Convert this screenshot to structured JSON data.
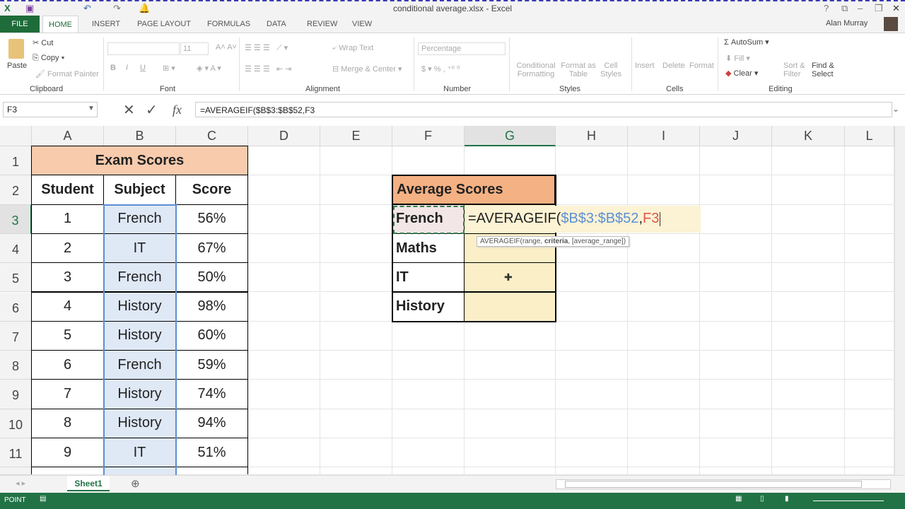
{
  "window": {
    "title": "conditional average.xlsx - Excel",
    "user": "Alan Murray",
    "controls": [
      "?",
      "⧉",
      "–",
      "❐",
      "✕"
    ]
  },
  "ribbon_tabs": [
    "FILE",
    "HOME",
    "INSERT",
    "PAGE LAYOUT",
    "FORMULAS",
    "DATA",
    "REVIEW",
    "VIEW"
  ],
  "ribbon": {
    "clipboard": {
      "paste": "Paste",
      "cut": "Cut",
      "copy": "Copy",
      "format_painter": "Format Painter",
      "label": "Clipboard"
    },
    "font": {
      "size": "11",
      "label": "Font",
      "bold": "B",
      "italic": "I",
      "underline": "U"
    },
    "alignment": {
      "wrap": "Wrap Text",
      "merge": "Merge & Center",
      "label": "Alignment"
    },
    "number": {
      "format": "Percentage",
      "label": "Number",
      "percent": "%"
    },
    "styles": {
      "conditional": "Conditional Formatting",
      "format_table": "Format as Table",
      "cell_styles": "Cell Styles",
      "label": "Styles"
    },
    "cells": {
      "insert": "Insert",
      "delete": "Delete",
      "format": "Format",
      "label": "Cells"
    },
    "editing": {
      "autosum": "AutoSum",
      "fill": "Fill",
      "clear": "Clear",
      "sort": "Sort & Filter",
      "find": "Find & Select",
      "label": "Editing"
    }
  },
  "formula_bar": {
    "name_box": "F3",
    "formula": "=AVERAGEIF($B$3:$B$52,F3",
    "fx": "fx"
  },
  "columns": [
    "A",
    "B",
    "C",
    "D",
    "E",
    "F",
    "G",
    "H",
    "I",
    "J",
    "K",
    "L"
  ],
  "rows": [
    "1",
    "2",
    "3",
    "4",
    "5",
    "6",
    "7",
    "8",
    "9",
    "10",
    "11"
  ],
  "exam": {
    "title": "Exam Scores",
    "headers": [
      "Student",
      "Subject",
      "Score"
    ],
    "data": [
      [
        "1",
        "French",
        "56%"
      ],
      [
        "2",
        "IT",
        "67%"
      ],
      [
        "3",
        "French",
        "50%"
      ],
      [
        "4",
        "History",
        "98%"
      ],
      [
        "5",
        "History",
        "60%"
      ],
      [
        "6",
        "French",
        "59%"
      ],
      [
        "7",
        "History",
        "74%"
      ],
      [
        "8",
        "History",
        "94%"
      ],
      [
        "9",
        "IT",
        "51%"
      ]
    ]
  },
  "averages": {
    "title": "Average Scores",
    "subjects": [
      "French",
      "Maths",
      "IT",
      "History"
    ]
  },
  "edit": {
    "prefix": "=AVERAGEIF(",
    "range": "$B$3:$B$52",
    "comma": ",",
    "criteria": "F3",
    "tooltip_pre": "AVERAGEIF(range, ",
    "tooltip_bold": "criteria",
    "tooltip_post": ", [average_range])"
  },
  "sheet_tabs": [
    "Sheet1"
  ],
  "status": {
    "mode": "POINT"
  },
  "colors": {
    "excel_green": "#217346",
    "exam_header": "#f8cbad",
    "avg_header": "#f4b183",
    "avg_cells": "#fbefc8",
    "range_blue": "#5b8fd6",
    "criteria_red": "#e0584a"
  }
}
